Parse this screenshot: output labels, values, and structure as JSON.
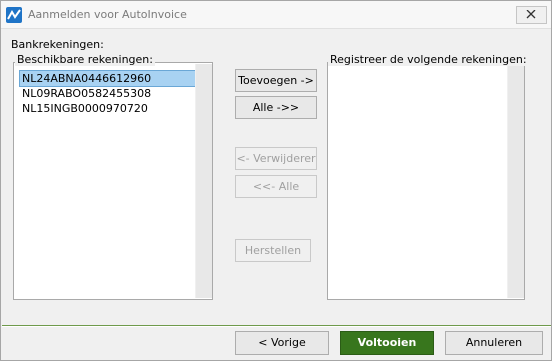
{
  "window": {
    "title": "Aanmelden voor AutoInvoice"
  },
  "section_label": "Bankrekeningen:",
  "available": {
    "label": "Beschikbare rekeningen:",
    "items": [
      "NL24ABNA0446612960",
      "NL09RABO0582455308",
      "NL15INGB0000970720"
    ],
    "selected_index": 0
  },
  "selected": {
    "label": "Registreer de volgende rekeningen:",
    "items": []
  },
  "buttons": {
    "add": "Toevoegen ->",
    "add_all": "Alle ->>",
    "remove": "<- Verwijderer",
    "remove_all": "<<- Alle",
    "reset": "Herstellen"
  },
  "footer": {
    "back": "< Vorige",
    "finish": "Voltooien",
    "cancel": "Annuleren"
  },
  "colors": {
    "primary": "#38761d",
    "selection": "#a8d2f2",
    "app_icon": "#1f74c7"
  },
  "icons": {
    "app": "autoinvoice-logo-icon",
    "close": "close-icon"
  }
}
